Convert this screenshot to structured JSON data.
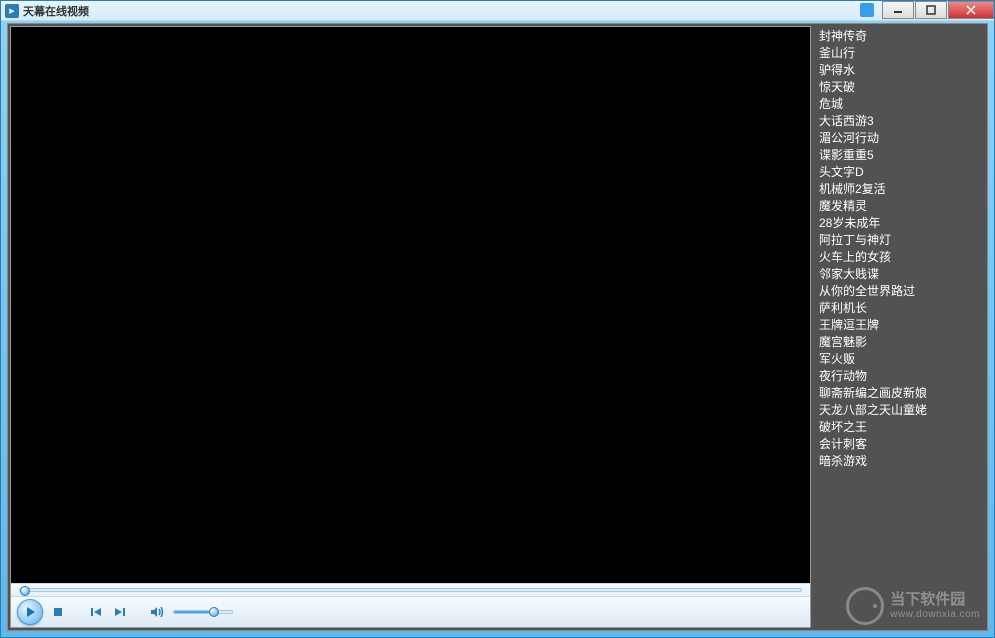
{
  "window": {
    "title": "天幕在线视频"
  },
  "playlist": {
    "items": [
      "封神传奇",
      "釜山行",
      "驴得水",
      "惊天破",
      "危城",
      "大话西游3",
      "湄公河行动",
      "谍影重重5",
      "头文字D",
      "机械师2复活",
      "魔发精灵",
      "28岁未成年",
      "阿拉丁与神灯",
      "火车上的女孩",
      "邻家大贱谍",
      "从你的全世界路过",
      "萨利机长",
      "王牌逗王牌",
      "魔宫魅影",
      "军火贩",
      "夜行动物",
      "聊斋新编之画皮新娘",
      "天龙八部之天山童姥",
      "破坏之王",
      "会计刺客",
      "暗杀游戏"
    ]
  },
  "watermark": {
    "name": "当下软件园",
    "url": "www.downxia.com"
  }
}
